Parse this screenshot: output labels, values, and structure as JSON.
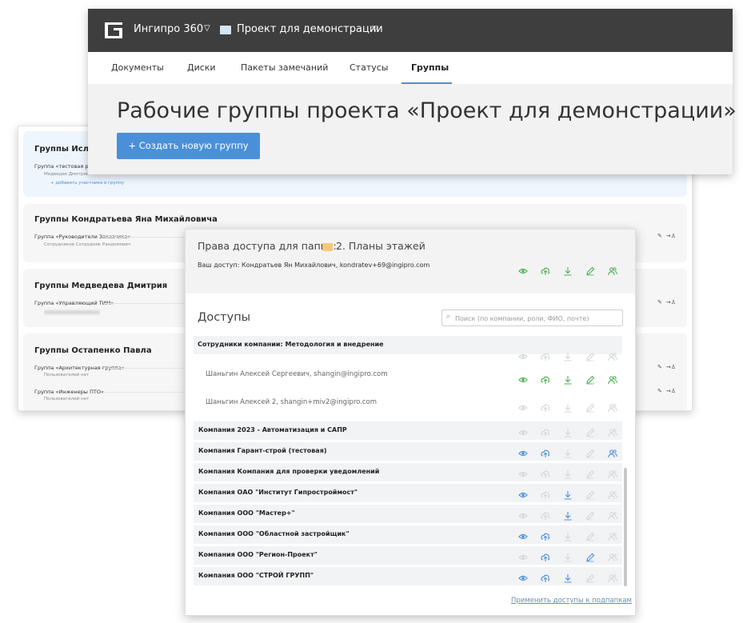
{
  "header": {
    "app_name": "Ингипро 360",
    "project_name": "Проект для демонстрации"
  },
  "tabs": [
    {
      "label": "Документы"
    },
    {
      "label": "Диски"
    },
    {
      "label": "Пакеты замечаний"
    },
    {
      "label": "Статусы"
    },
    {
      "label": "Группы",
      "active": true
    }
  ],
  "page": {
    "title": "Рабочие группы проекта «Проект для демонстрации»",
    "create_button": "+ Создать новую группу"
  },
  "groups_panel": {
    "cards": [
      {
        "title": "Группы Исла",
        "line": "Группа «тестовая р",
        "sub": "Медведев Дмитрий",
        "add_link": "+ добавить участника в группу"
      },
      {
        "title": "Группы Кондратьева Яна Михайловича",
        "line": "Группа «Руководители Заказчика»",
        "sub": "Сотрудников Сотрудник Рандомович"
      },
      {
        "title": "Группы Медведева Дмитрия",
        "line": "Группа «Управляющий ТИМ»"
      },
      {
        "title": "Группы Остапенко Павла",
        "line": "Группа «Архитектурная группа»",
        "sub": "Пользователей нет",
        "line2": "Группа «Инженеры ПТО»",
        "sub2": "Пользователей нет"
      }
    ]
  },
  "modal": {
    "title": "Права доступа для папки:",
    "folder_name": "2. Планы этажей",
    "my_access": "Ваш доступ: Кондратьев Ян Михайлович, kondratev+69@ingipro.com",
    "section_title": "Доступы",
    "search_placeholder": "Поиск (по компании, роли, ФИО, почте)",
    "employees_header": "Сотрудники компании: Методология и внедрение",
    "people": [
      {
        "name": "Шаньгин Алексей Сергеевич, shangin@ingipro.com"
      },
      {
        "name": "Шаньгин Алексей 2, shangin+miv2@ingipro.com"
      }
    ],
    "companies": [
      {
        "name": "Компания 2023 - Автоматизация и САПР"
      },
      {
        "name": "Компания Гарант-строй (тестовая)"
      },
      {
        "name": "Компания Компания для проверки уведомлений"
      },
      {
        "name": "Компания ОАО \"Институт Гипростроймост\""
      },
      {
        "name": "Компания ООО \"Мастер+\""
      },
      {
        "name": "Компания ООО \"Областной застройщик\""
      },
      {
        "name": "Компания ООО \"Регион-Проект\""
      },
      {
        "name": "Компания ООО \"СТРОЙ ГРУПП\""
      }
    ],
    "apply_link": "Применить доступы к подпапкам"
  },
  "colors": {
    "accent": "#4a90d9",
    "granted_green": "#4caf50",
    "granted_blue": "#4a90d9",
    "disabled": "#d3d6db",
    "topbar": "#3e3e3e"
  }
}
